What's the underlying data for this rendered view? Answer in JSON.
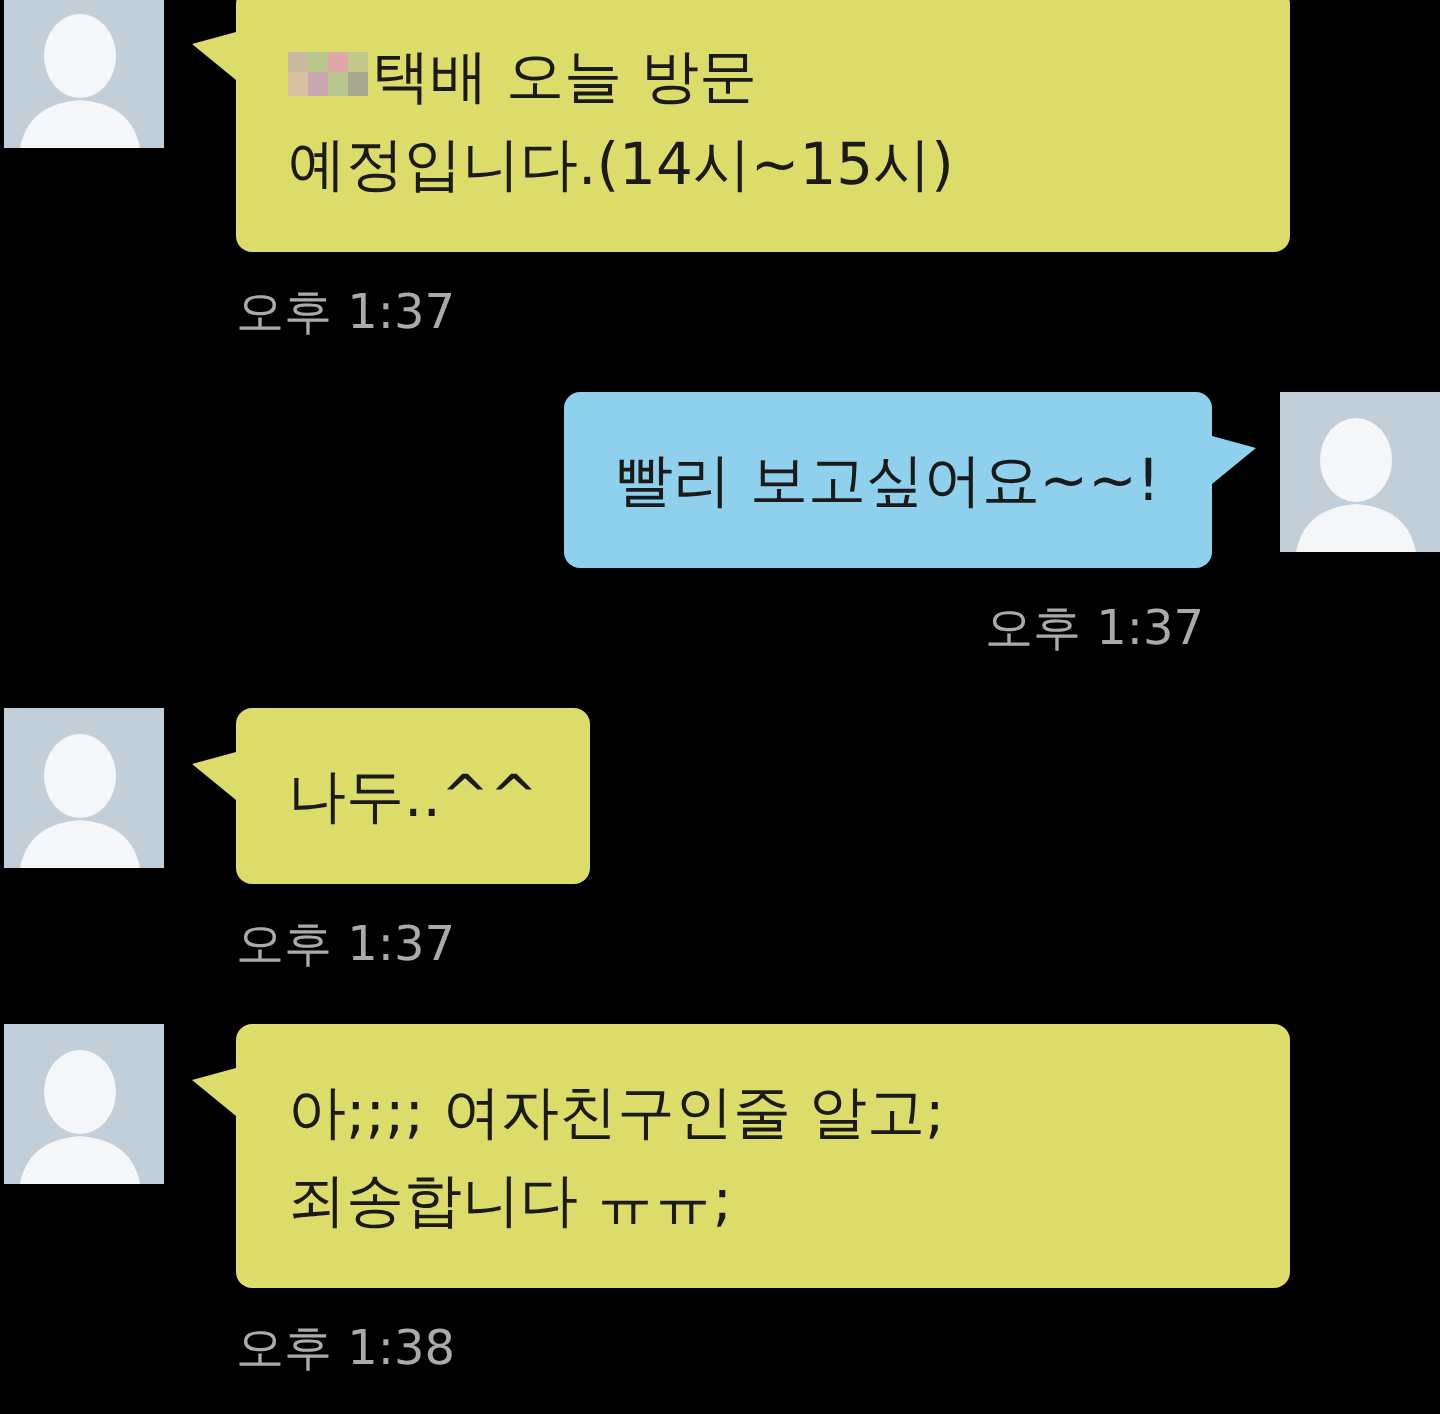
{
  "messages": [
    {
      "kind": "received",
      "blurred": true,
      "text": "택배 오늘 방문\n예정입니다.(14시~15시)",
      "time": "오후 1:37"
    },
    {
      "kind": "sent",
      "blurred": false,
      "text": "빨리 보고싶어요~~!",
      "time": "오후 1:37"
    },
    {
      "kind": "received",
      "blurred": false,
      "text": "나두..^^",
      "time": "오후 1:37"
    },
    {
      "kind": "received",
      "blurred": false,
      "text": "아;;;; 여자친구인줄 알고;\n죄송합니다 ㅠㅠ;",
      "time": "오후 1:38"
    }
  ]
}
